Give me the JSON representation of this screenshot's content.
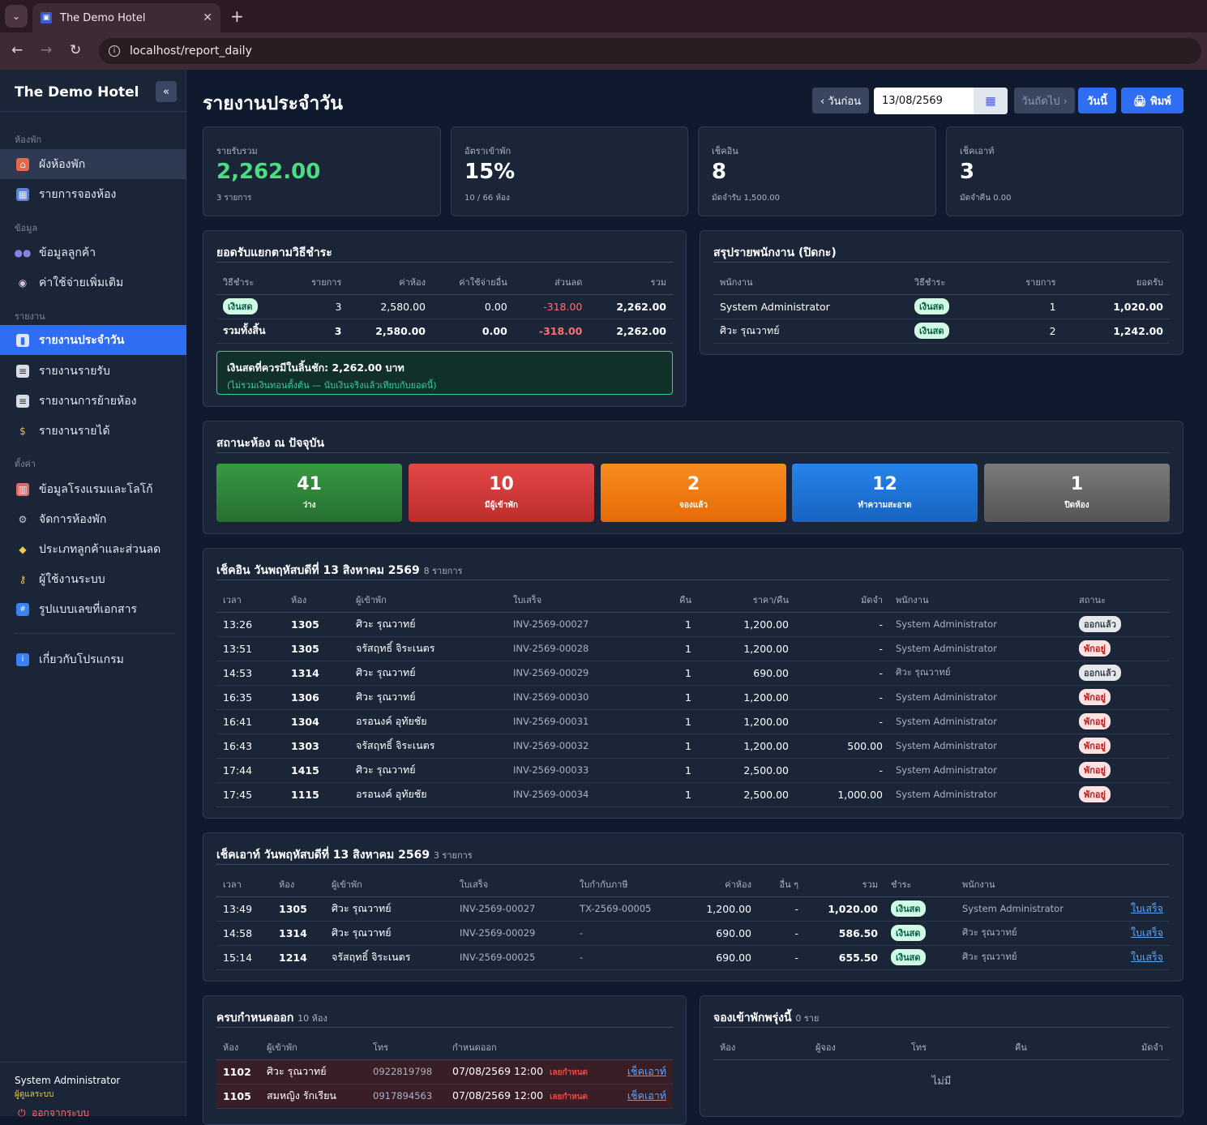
{
  "browser": {
    "tab_title": "The Demo Hotel",
    "url": "localhost/report_daily"
  },
  "sidebar": {
    "brand": "The Demo Hotel",
    "collapse_icon": "«",
    "sections": {
      "rooms": "ห้องพัก",
      "data": "ข้อมูล",
      "reports": "รายงาน",
      "settings": "ตั้งค่า"
    },
    "items": [
      {
        "label": "ผังห้องพัก",
        "icon": "house-icon"
      },
      {
        "label": "รายการจองห้อง",
        "icon": "calendar-icon"
      },
      {
        "label": "ข้อมูลลูกค้า",
        "icon": "users-icon"
      },
      {
        "label": "ค่าใช้จ่ายเพิ่มเติม",
        "icon": "dish-icon"
      },
      {
        "label": "รายงานประจำวัน",
        "icon": "chart-icon"
      },
      {
        "label": "รายงานรายรับ",
        "icon": "document-icon"
      },
      {
        "label": "รายงานการย้ายห้อง",
        "icon": "document-icon"
      },
      {
        "label": "รายงานรายได้",
        "icon": "moneybag-icon"
      },
      {
        "label": "ข้อมูลโรงแรมและโลโก้",
        "icon": "hotel-icon"
      },
      {
        "label": "จัดการห้องพัก",
        "icon": "gear-icon"
      },
      {
        "label": "ประเภทลูกค้าและส่วนลด",
        "icon": "tag-icon"
      },
      {
        "label": "ผู้ใช้งานระบบ",
        "icon": "key-icon"
      },
      {
        "label": "รูปแบบเลขที่เอกสาร",
        "icon": "numbers-icon"
      },
      {
        "label": "เกี่ยวกับโปรแกรม",
        "icon": "info-icon"
      }
    ],
    "user_name": "System Administrator",
    "user_role": "ผู้ดูแลระบบ",
    "logout": "ออกจากระบบ"
  },
  "header": {
    "title": "รายงานประจำวัน",
    "prev": "‹ วันก่อน",
    "date": "13/08/2569",
    "next": "วันถัดไป ›",
    "today": "วันนี้",
    "print": "🖨 พิมพ์"
  },
  "stats": [
    {
      "label": "รายรับรวม",
      "value": "2,262.00",
      "sub": "3 รายการ"
    },
    {
      "label": "อัตราเข้าพัก",
      "value": "15%",
      "sub": "10 / 66 ห้อง"
    },
    {
      "label": "เช็คอิน",
      "value": "8",
      "sub": "มัดจำรับ 1,500.00"
    },
    {
      "label": "เช็คเอาท์",
      "value": "3",
      "sub": "มัดจำคืน 0.00"
    }
  ],
  "payment": {
    "title": "ยอดรับแยกตามวิธีชำระ",
    "headers": [
      "วิธีชำระ",
      "รายการ",
      "ค่าห้อง",
      "ค่าใช้จ่ายอื่น",
      "ส่วนลด",
      "รวม"
    ],
    "rows": [
      {
        "method": "เงินสด",
        "count": "3",
        "room": "2,580.00",
        "other": "0.00",
        "discount": "-318.00",
        "total": "2,262.00"
      }
    ],
    "total": {
      "label": "รวมทั้งสิ้น",
      "count": "3",
      "room": "2,580.00",
      "other": "0.00",
      "discount": "-318.00",
      "total": "2,262.00"
    },
    "alert_title": "เงินสดที่ควรมีในลิ้นชัก: 2,262.00 บาท",
    "alert_sub": "(ไม่รวมเงินทอนตั้งต้น — นับเงินจริงแล้วเทียบกับยอดนี้)"
  },
  "staff": {
    "title": "สรุปรายพนักงาน (ปิดกะ)",
    "headers": [
      "พนักงาน",
      "วิธีชำระ",
      "รายการ",
      "ยอดรับ"
    ],
    "rows": [
      {
        "name": "System Administrator",
        "method": "เงินสด",
        "count": "1",
        "amount": "1,020.00"
      },
      {
        "name": "ศิวะ รุณวาทย์",
        "method": "เงินสด",
        "count": "2",
        "amount": "1,242.00"
      }
    ]
  },
  "room_status": {
    "title": "สถานะห้อง ณ ปัจจุบัน",
    "items": [
      {
        "count": "41",
        "label": "ว่าง",
        "color": "#2f8a3a"
      },
      {
        "count": "10",
        "label": "มีผู้เข้าพัก",
        "color": "#d63a3a"
      },
      {
        "count": "2",
        "label": "จองแล้ว",
        "color": "#f27a12"
      },
      {
        "count": "12",
        "label": "ทำความสะอาด",
        "color": "#1f76d9"
      },
      {
        "count": "1",
        "label": "ปิดห้อง",
        "color": "#666666"
      }
    ]
  },
  "checkin": {
    "title": "เช็คอิน วันพฤหัสบดีที่ 13 สิงหาคม 2569",
    "count": "8 รายการ",
    "headers": [
      "เวลา",
      "ห้อง",
      "ผู้เข้าพัก",
      "ใบเสร็จ",
      "คืน",
      "ราคา/คืน",
      "มัดจำ",
      "พนักงาน",
      "สถานะ"
    ],
    "rows": [
      {
        "time": "13:26",
        "room": "1305",
        "guest": "ศิวะ รุณวาทย์",
        "invoice": "INV-2569-00027",
        "nights": "1",
        "price": "1,200.00",
        "deposit": "-",
        "staff": "System Administrator",
        "status": "ออกแล้ว",
        "kind": "out"
      },
      {
        "time": "13:51",
        "room": "1305",
        "guest": "จรัสฤทธิ์ จิระเนตร",
        "invoice": "INV-2569-00028",
        "nights": "1",
        "price": "1,200.00",
        "deposit": "-",
        "staff": "System Administrator",
        "status": "พักอยู่",
        "kind": "stay"
      },
      {
        "time": "14:53",
        "room": "1314",
        "guest": "ศิวะ รุณวาทย์",
        "invoice": "INV-2569-00029",
        "nights": "1",
        "price": "690.00",
        "deposit": "-",
        "staff": "ศิวะ รุณวาทย์",
        "status": "ออกแล้ว",
        "kind": "out"
      },
      {
        "time": "16:35",
        "room": "1306",
        "guest": "ศิวะ รุณวาทย์",
        "invoice": "INV-2569-00030",
        "nights": "1",
        "price": "1,200.00",
        "deposit": "-",
        "staff": "System Administrator",
        "status": "พักอยู่",
        "kind": "stay"
      },
      {
        "time": "16:41",
        "room": "1304",
        "guest": "อรอนงค์ อุทัยชัย",
        "invoice": "INV-2569-00031",
        "nights": "1",
        "price": "1,200.00",
        "deposit": "-",
        "staff": "System Administrator",
        "status": "พักอยู่",
        "kind": "stay"
      },
      {
        "time": "16:43",
        "room": "1303",
        "guest": "จรัสฤทธิ์ จิระเนตร",
        "invoice": "INV-2569-00032",
        "nights": "1",
        "price": "1,200.00",
        "deposit": "500.00",
        "staff": "System Administrator",
        "status": "พักอยู่",
        "kind": "stay"
      },
      {
        "time": "17:44",
        "room": "1415",
        "guest": "ศิวะ รุณวาทย์",
        "invoice": "INV-2569-00033",
        "nights": "1",
        "price": "2,500.00",
        "deposit": "-",
        "staff": "System Administrator",
        "status": "พักอยู่",
        "kind": "stay"
      },
      {
        "time": "17:45",
        "room": "1115",
        "guest": "อรอนงค์ อุทัยชัย",
        "invoice": "INV-2569-00034",
        "nights": "1",
        "price": "2,500.00",
        "deposit": "1,000.00",
        "staff": "System Administrator",
        "status": "พักอยู่",
        "kind": "stay"
      }
    ]
  },
  "checkout": {
    "title": "เช็คเอาท์ วันพฤหัสบดีที่ 13 สิงหาคม 2569",
    "count": "3 รายการ",
    "headers": [
      "เวลา",
      "ห้อง",
      "ผู้เข้าพัก",
      "ใบเสร็จ",
      "ใบกำกับภาษี",
      "ค่าห้อง",
      "อื่น ๆ",
      "รวม",
      "ชำระ",
      "พนักงาน",
      ""
    ],
    "rows": [
      {
        "time": "13:49",
        "room": "1305",
        "guest": "ศิวะ รุณวาทย์",
        "invoice": "INV-2569-00027",
        "tax": "TX-2569-00005",
        "room_price": "1,200.00",
        "other": "-",
        "total": "1,020.00",
        "method": "เงินสด",
        "staff": "System Administrator",
        "link": "ใบเสร็จ"
      },
      {
        "time": "14:58",
        "room": "1314",
        "guest": "ศิวะ รุณวาทย์",
        "invoice": "INV-2569-00029",
        "tax": "-",
        "room_price": "690.00",
        "other": "-",
        "total": "586.50",
        "method": "เงินสด",
        "staff": "ศิวะ รุณวาทย์",
        "link": "ใบเสร็จ"
      },
      {
        "time": "15:14",
        "room": "1214",
        "guest": "จรัสฤทธิ์ จิระเนตร",
        "invoice": "INV-2569-00025",
        "tax": "-",
        "room_price": "690.00",
        "other": "-",
        "total": "655.50",
        "method": "เงินสด",
        "staff": "ศิวะ รุณวาทย์",
        "link": "ใบเสร็จ"
      }
    ]
  },
  "due": {
    "title": "ครบกำหนดออก",
    "count": "10 ห้อง",
    "headers": [
      "ห้อง",
      "ผู้เข้าพัก",
      "โทร",
      "กำหนดออก",
      ""
    ],
    "rows": [
      {
        "room": "1102",
        "guest": "ศิวะ รุณวาทย์",
        "phone": "0922819798",
        "due": "07/08/2569 12:00",
        "flag": "เลยกำหนด",
        "link": "เช็คเอาท์"
      },
      {
        "room": "1105",
        "guest": "สมหญิง รักเรียน",
        "phone": "0917894563",
        "due": "07/08/2569 12:00",
        "flag": "เลยกำหนด",
        "link": "เช็คเอาท์"
      }
    ]
  },
  "tomorrow": {
    "title": "จองเข้าพักพรุ่งนี้",
    "count": "0 ราย",
    "headers": [
      "ห้อง",
      "ผู้จอง",
      "โทร",
      "คืน",
      "มัดจำ"
    ],
    "empty": "ไม่มี"
  }
}
